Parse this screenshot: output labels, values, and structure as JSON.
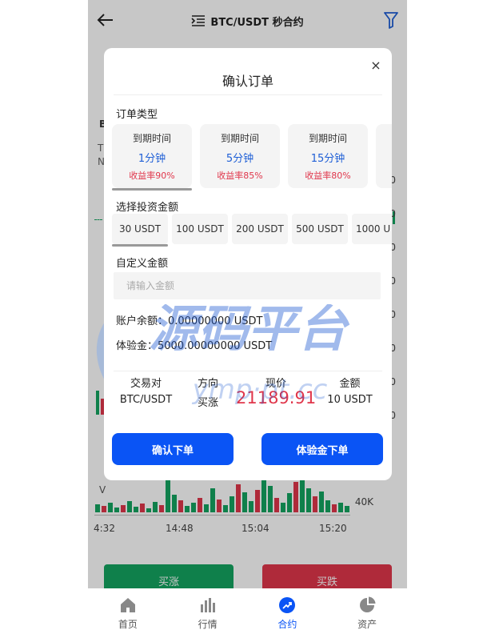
{
  "header": {
    "title": "BTC/USDT 秒合约"
  },
  "chart_bg": {
    "left_letter": "B",
    "left_letter2": "T",
    "left_letter3": "N",
    "axis_right": [
      "0",
      "0",
      "0",
      "0",
      "0",
      "0",
      "0",
      "0",
      "0"
    ],
    "vol_label": "V",
    "vol_axis": "40K",
    "time_labels": [
      "4:32",
      "14:48",
      "15:04",
      "15:20"
    ]
  },
  "bg_actions": {
    "buy": "买涨",
    "sell": "买跌"
  },
  "modal": {
    "title": "确认订单",
    "close": "×",
    "order_type_label": "订单类型",
    "order_types": [
      {
        "label": "到期时间",
        "duration": "1分钟",
        "rate": "收益率90%",
        "selected": true
      },
      {
        "label": "到期时间",
        "duration": "5分钟",
        "rate": "收益率85%",
        "selected": false
      },
      {
        "label": "到期时间",
        "duration": "15分钟",
        "rate": "收益率80%",
        "selected": false
      }
    ],
    "amount_label": "选择投资金额",
    "amounts": [
      {
        "label": "30 USDT",
        "selected": true
      },
      {
        "label": "100 USDT",
        "selected": false
      },
      {
        "label": "200 USDT",
        "selected": false
      },
      {
        "label": "500 USDT",
        "selected": false
      },
      {
        "label": "1000 U",
        "selected": false
      }
    ],
    "custom_label": "自定义金额",
    "custom_placeholder": "请输入金额",
    "balance": "账户余额：0.00000000 USDT",
    "trial": "体验金：5000.00000000 USDT",
    "table": {
      "headers": [
        "交易对",
        "方向",
        "现价",
        "金额"
      ],
      "values": [
        "BTC/USDT",
        "买涨",
        "21189.91",
        "10 USDT"
      ]
    },
    "confirm_button": "确认下单",
    "trial_button": "体验金下单"
  },
  "watermark": {
    "text": "源码平台",
    "url": "ymp·pt.cc"
  },
  "nav": [
    {
      "label": "首页",
      "icon": "home-icon",
      "active": false
    },
    {
      "label": "行情",
      "icon": "chart-bars-icon",
      "active": false
    },
    {
      "label": "合约",
      "icon": "trend-icon",
      "active": true
    },
    {
      "label": "资产",
      "icon": "pie-chart-icon",
      "active": false
    }
  ],
  "colors": {
    "accent": "#0a54f5",
    "up": "#14a561",
    "down": "#e0364b"
  }
}
